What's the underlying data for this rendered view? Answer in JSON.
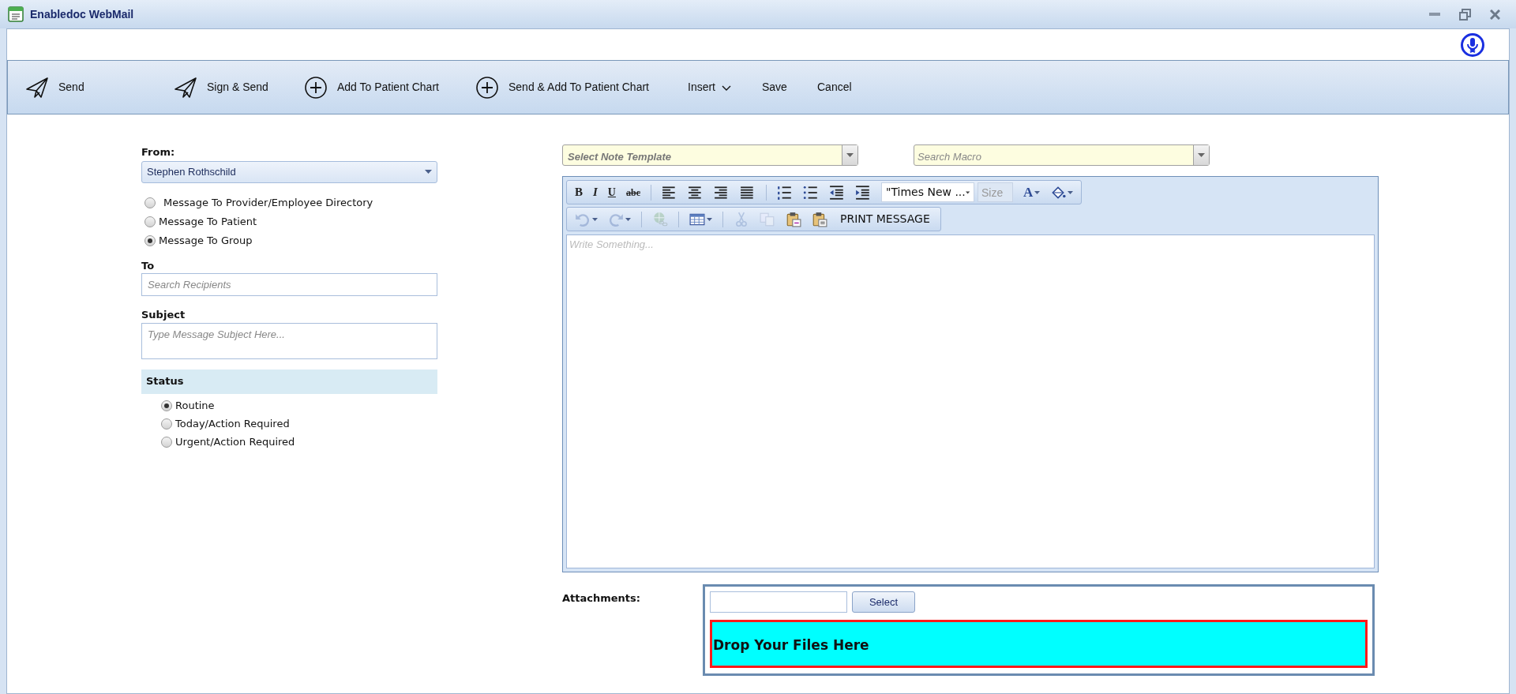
{
  "window": {
    "title": "Enabledoc WebMail"
  },
  "toolbar": [
    {
      "label": "Send",
      "kind": "plane"
    },
    {
      "label": "Sign & Send",
      "kind": "plane"
    },
    {
      "label": "Add To Patient Chart",
      "kind": "plus"
    },
    {
      "label": "Send & Add To Patient Chart",
      "kind": "plus"
    },
    {
      "label": "Insert",
      "kind": "menu"
    },
    {
      "label": "Save",
      "kind": "plain"
    },
    {
      "label": "Cancel",
      "kind": "plain"
    }
  ],
  "form": {
    "from_label": "From:",
    "from_value": "Stephen Rothschild",
    "recipient_types": [
      {
        "label": "Message To Provider/Employee Directory",
        "selected": false
      },
      {
        "label": "Message To Patient",
        "selected": false
      },
      {
        "label": "Message To Group",
        "selected": true
      }
    ],
    "to_label": "To",
    "to_placeholder": "Search Recipients",
    "subject_label": "Subject",
    "subject_placeholder": "Type Message Subject Here...",
    "status_label": "Status",
    "statuses": [
      {
        "label": "Routine",
        "selected": true
      },
      {
        "label": "Today/Action Required",
        "selected": false
      },
      {
        "label": "Urgent/Action Required",
        "selected": false
      }
    ]
  },
  "note_template": {
    "placeholder": "Select Note Template"
  },
  "macro": {
    "placeholder": "Search Macro"
  },
  "editor": {
    "rows": [
      [
        {
          "kind": "bold",
          "glyph": "B",
          "disabled": false
        },
        {
          "kind": "italic",
          "glyph": "I",
          "disabled": false
        },
        {
          "kind": "underline",
          "glyph": "U",
          "disabled": false
        },
        {
          "kind": "strike",
          "glyph": "abc",
          "disabled": false
        },
        {
          "kind": "sep"
        },
        {
          "kind": "align-left",
          "disabled": false
        },
        {
          "kind": "align-center",
          "disabled": false
        },
        {
          "kind": "align-right",
          "disabled": false
        },
        {
          "kind": "justify",
          "disabled": false
        },
        {
          "kind": "sep"
        },
        {
          "kind": "ordered-list",
          "disabled": false
        },
        {
          "kind": "bullet-list",
          "disabled": false
        },
        {
          "kind": "outdent",
          "disabled": false
        },
        {
          "kind": "indent",
          "disabled": false
        },
        {
          "kind": "font",
          "value": "\"Times New ..."
        },
        {
          "kind": "size",
          "placeholder": "Size"
        },
        {
          "kind": "font-color",
          "glyph": "A",
          "disabled": false,
          "dropdown": true
        },
        {
          "kind": "fill",
          "disabled": false,
          "dropdown": true
        }
      ],
      [
        {
          "kind": "undo",
          "disabled": true,
          "dropdown": true
        },
        {
          "kind": "redo",
          "disabled": true,
          "dropdown": true
        },
        {
          "kind": "sep"
        },
        {
          "kind": "link",
          "disabled": true
        },
        {
          "kind": "sep"
        },
        {
          "kind": "table",
          "disabled": false,
          "dropdown": true
        },
        {
          "kind": "sep"
        },
        {
          "kind": "cut",
          "disabled": true
        },
        {
          "kind": "copy",
          "disabled": true
        },
        {
          "kind": "paste-html",
          "disabled": false
        },
        {
          "kind": "paste-text",
          "disabled": false
        },
        {
          "kind": "print",
          "label": "PRINT MESSAGE"
        }
      ]
    ],
    "placeholder": "Write Something..."
  },
  "attachments": {
    "label": "Attachments:",
    "select_button": "Select",
    "drop_zone": "Drop Your Files Here"
  }
}
